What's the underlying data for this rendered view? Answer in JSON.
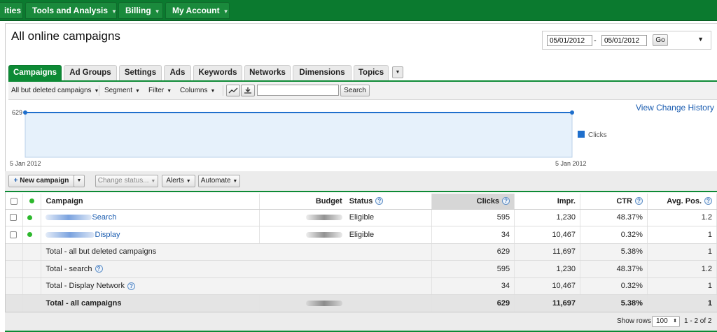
{
  "topnav": {
    "items": [
      {
        "label": "ities",
        "has_caret": false
      },
      {
        "label": "Tools and Analysis",
        "has_caret": true
      },
      {
        "label": "Billing",
        "has_caret": true
      },
      {
        "label": "My Account",
        "has_caret": true
      }
    ]
  },
  "page": {
    "title": "All online campaigns"
  },
  "daterange": {
    "start": "05/01/2012",
    "separator": "-",
    "end": "05/01/2012",
    "go_label": "Go"
  },
  "tabs": [
    "Campaigns",
    "Ad Groups",
    "Settings",
    "Ads",
    "Keywords",
    "Networks",
    "Dimensions",
    "Topics"
  ],
  "toolbar": {
    "filter_view": "All but deleted campaigns",
    "segment": "Segment",
    "filter": "Filter",
    "columns": "Columns",
    "search_label": "Search",
    "search_value": ""
  },
  "chart_data": {
    "type": "line",
    "y_tick": "629",
    "x_start_label": "5 Jan 2012",
    "x_end_label": "5 Jan 2012",
    "series": [
      {
        "name": "Clicks",
        "values": [
          629,
          629
        ]
      }
    ],
    "color": "#1f6fcc"
  },
  "links": {
    "view_change_history": "View Change History"
  },
  "actions": {
    "new_campaign": "New campaign",
    "change_status": "Change status...",
    "alerts": "Alerts",
    "automate": "Automate"
  },
  "table": {
    "headers": {
      "campaign": "Campaign",
      "budget": "Budget",
      "status": "Status",
      "clicks": "Clicks",
      "impr": "Impr.",
      "ctr": "CTR",
      "avg_pos": "Avg. Pos."
    },
    "rows": [
      {
        "name": "Search",
        "status": "Eligible",
        "clicks": "595",
        "impr": "1,230",
        "ctr": "48.37%",
        "avg_pos": "1.2"
      },
      {
        "name": "Display",
        "status": "Eligible",
        "clicks": "34",
        "impr": "10,467",
        "ctr": "0.32%",
        "avg_pos": "1"
      }
    ],
    "totals": [
      {
        "label": "Total - all but deleted campaigns",
        "help": false,
        "clicks": "629",
        "impr": "11,697",
        "ctr": "5.38%",
        "avg_pos": "1"
      },
      {
        "label": "Total - search",
        "help": true,
        "clicks": "595",
        "impr": "1,230",
        "ctr": "48.37%",
        "avg_pos": "1.2"
      },
      {
        "label": "Total - Display Network",
        "help": true,
        "clicks": "34",
        "impr": "10,467",
        "ctr": "0.32%",
        "avg_pos": "1"
      }
    ],
    "grand_total": {
      "label": "Total - all campaigns",
      "clicks": "629",
      "impr": "11,697",
      "ctr": "5.38%",
      "avg_pos": "1"
    }
  },
  "footer": {
    "show_rows_label": "Show rows",
    "rows_value": "100",
    "range": "1 - 2 of 2"
  }
}
